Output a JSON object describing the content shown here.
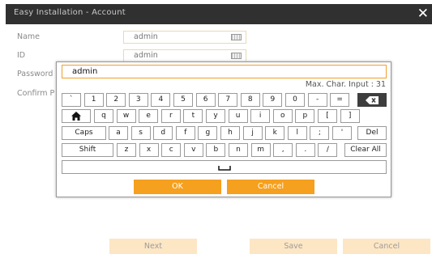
{
  "window": {
    "title": "Easy Installation - Account",
    "close_glyph": "✕"
  },
  "form": {
    "name_label": "Name",
    "name_value": "admin",
    "id_label": "ID",
    "id_value": "admin",
    "password_label": "Password",
    "confirm_label": "Confirm P"
  },
  "keyboard": {
    "input_value": "admin",
    "max_chars": "Max. Char. Input : 31",
    "row1": [
      "`",
      "1",
      "2",
      "3",
      "4",
      "5",
      "6",
      "7",
      "8",
      "9",
      "0",
      "-",
      "="
    ],
    "row2": [
      "q",
      "w",
      "e",
      "r",
      "t",
      "y",
      "u",
      "i",
      "o",
      "p",
      "[",
      "]"
    ],
    "row3": [
      "a",
      "s",
      "d",
      "f",
      "g",
      "h",
      "j",
      "k",
      "l",
      ";",
      "'"
    ],
    "row4": [
      "z",
      "x",
      "c",
      "v",
      "b",
      "n",
      "m",
      ",",
      ".",
      "/"
    ],
    "caps_label": "Caps",
    "shift_label": "Shift",
    "del_label": "Del",
    "clear_label": "Clear All",
    "ok_label": "OK",
    "cancel_label": "Cancel",
    "icons": {
      "home": "home-icon",
      "backspace": "backspace-icon",
      "space": "space-bar-icon"
    }
  },
  "footer": {
    "next_label": "Next",
    "save_label": "Save",
    "cancel_label": "Cancel"
  },
  "colors": {
    "accent": "#f5a01e",
    "footer_button": "#fde6c4",
    "titlebar": "#303030"
  }
}
